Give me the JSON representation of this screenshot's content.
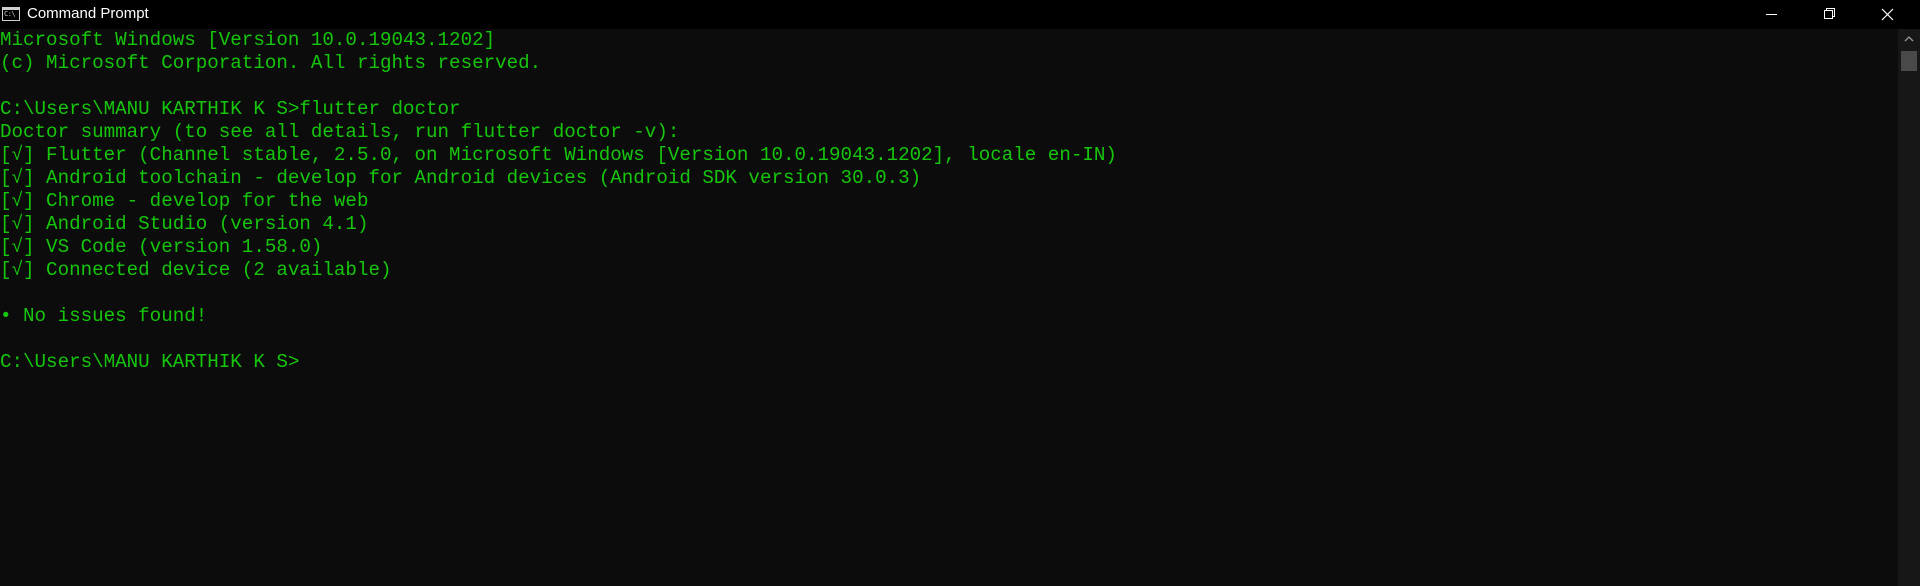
{
  "window": {
    "title": "Command Prompt",
    "icon": "cmd-console-icon",
    "icon_text": "C:\\",
    "controls": {
      "minimize": "minimize-icon",
      "restore": "restore-icon",
      "close": "close-icon"
    }
  },
  "colors": {
    "terminal_background": "#0c0c0c",
    "terminal_text": "#16c60c",
    "titlebar_background": "#000000",
    "titlebar_text": "#ffffff"
  },
  "terminal": {
    "lines": [
      "Microsoft Windows [Version 10.0.19043.1202]",
      "(c) Microsoft Corporation. All rights reserved.",
      "",
      "C:\\Users\\MANU KARTHIK K S>flutter doctor",
      "Doctor summary (to see all details, run flutter doctor -v):",
      "[√] Flutter (Channel stable, 2.5.0, on Microsoft Windows [Version 10.0.19043.1202], locale en-IN)",
      "[√] Android toolchain - develop for Android devices (Android SDK version 30.0.3)",
      "[√] Chrome - develop for the web",
      "[√] Android Studio (version 4.1)",
      "[√] VS Code (version 1.58.0)",
      "[√] Connected device (2 available)",
      "",
      "• No issues found!",
      "",
      "C:\\Users\\MANU KARTHIK K S>"
    ]
  },
  "scrollbar": {
    "up_arrow": "chevron-up-icon"
  }
}
